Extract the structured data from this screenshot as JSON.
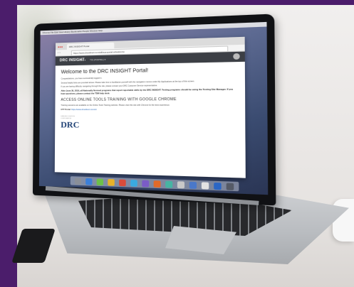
{
  "menubar": {
    "left": "Chrome  File  Edit  View  History  Bookmarks  People  Window  Help",
    "right": ""
  },
  "browser": {
    "tab_title": "DRC INSIGHT Portal",
    "url": "https://www.drcedirect.com/all/eca-portal-ui/welcome"
  },
  "app": {
    "brand_prefix": "DRC",
    "brand_suffix": "INSIGHT",
    "nav_items": [
      "TIDE ▾",
      "TIS (PORTAL) ▾"
    ]
  },
  "content": {
    "heading": "Welcome to the DRC INSIGHT Portal!",
    "para1": "Congratulations, you have successfully logged in.",
    "para2": "Several helpful links are provided above. Please take time to familiarize yourself with the navigation menus under My Applications at the top of this screen.",
    "para3": "If you are having difficulty navigating through the site, please contact your DRC Customer Service representative.",
    "bold_para": "After June 30, 2016, all Nationally Normed programs that report reportable skills by the DRC INSIGHT. Testing programs should be using the Testing Site Manager. If you have questions, please contact the TSM help desk.",
    "subheading": "ACCESS ONLINE TOOLS TRAINING WITH GOOGLE CHROME",
    "para4": "Training sessions are available on the Online Tools Training website. Please view this site with Chrome for the best experience.",
    "link_label": "OTT Portal:",
    "link_url": "https://www.drcedirect.com/ott"
  },
  "logo": {
    "top_text": "DATA RECOGNITION CORPORATION",
    "text": "DRC"
  },
  "dock_colors": [
    "#8a8f98",
    "#3b7fd9",
    "#6cc04a",
    "#e8b12a",
    "#d94b3b",
    "#3aa9e0",
    "#7a5cc7",
    "#e06a2a",
    "#46b4a3",
    "#c8c8c8",
    "#4a78c9",
    "#e2e2e2",
    "#2b66c4",
    "#555a66"
  ]
}
